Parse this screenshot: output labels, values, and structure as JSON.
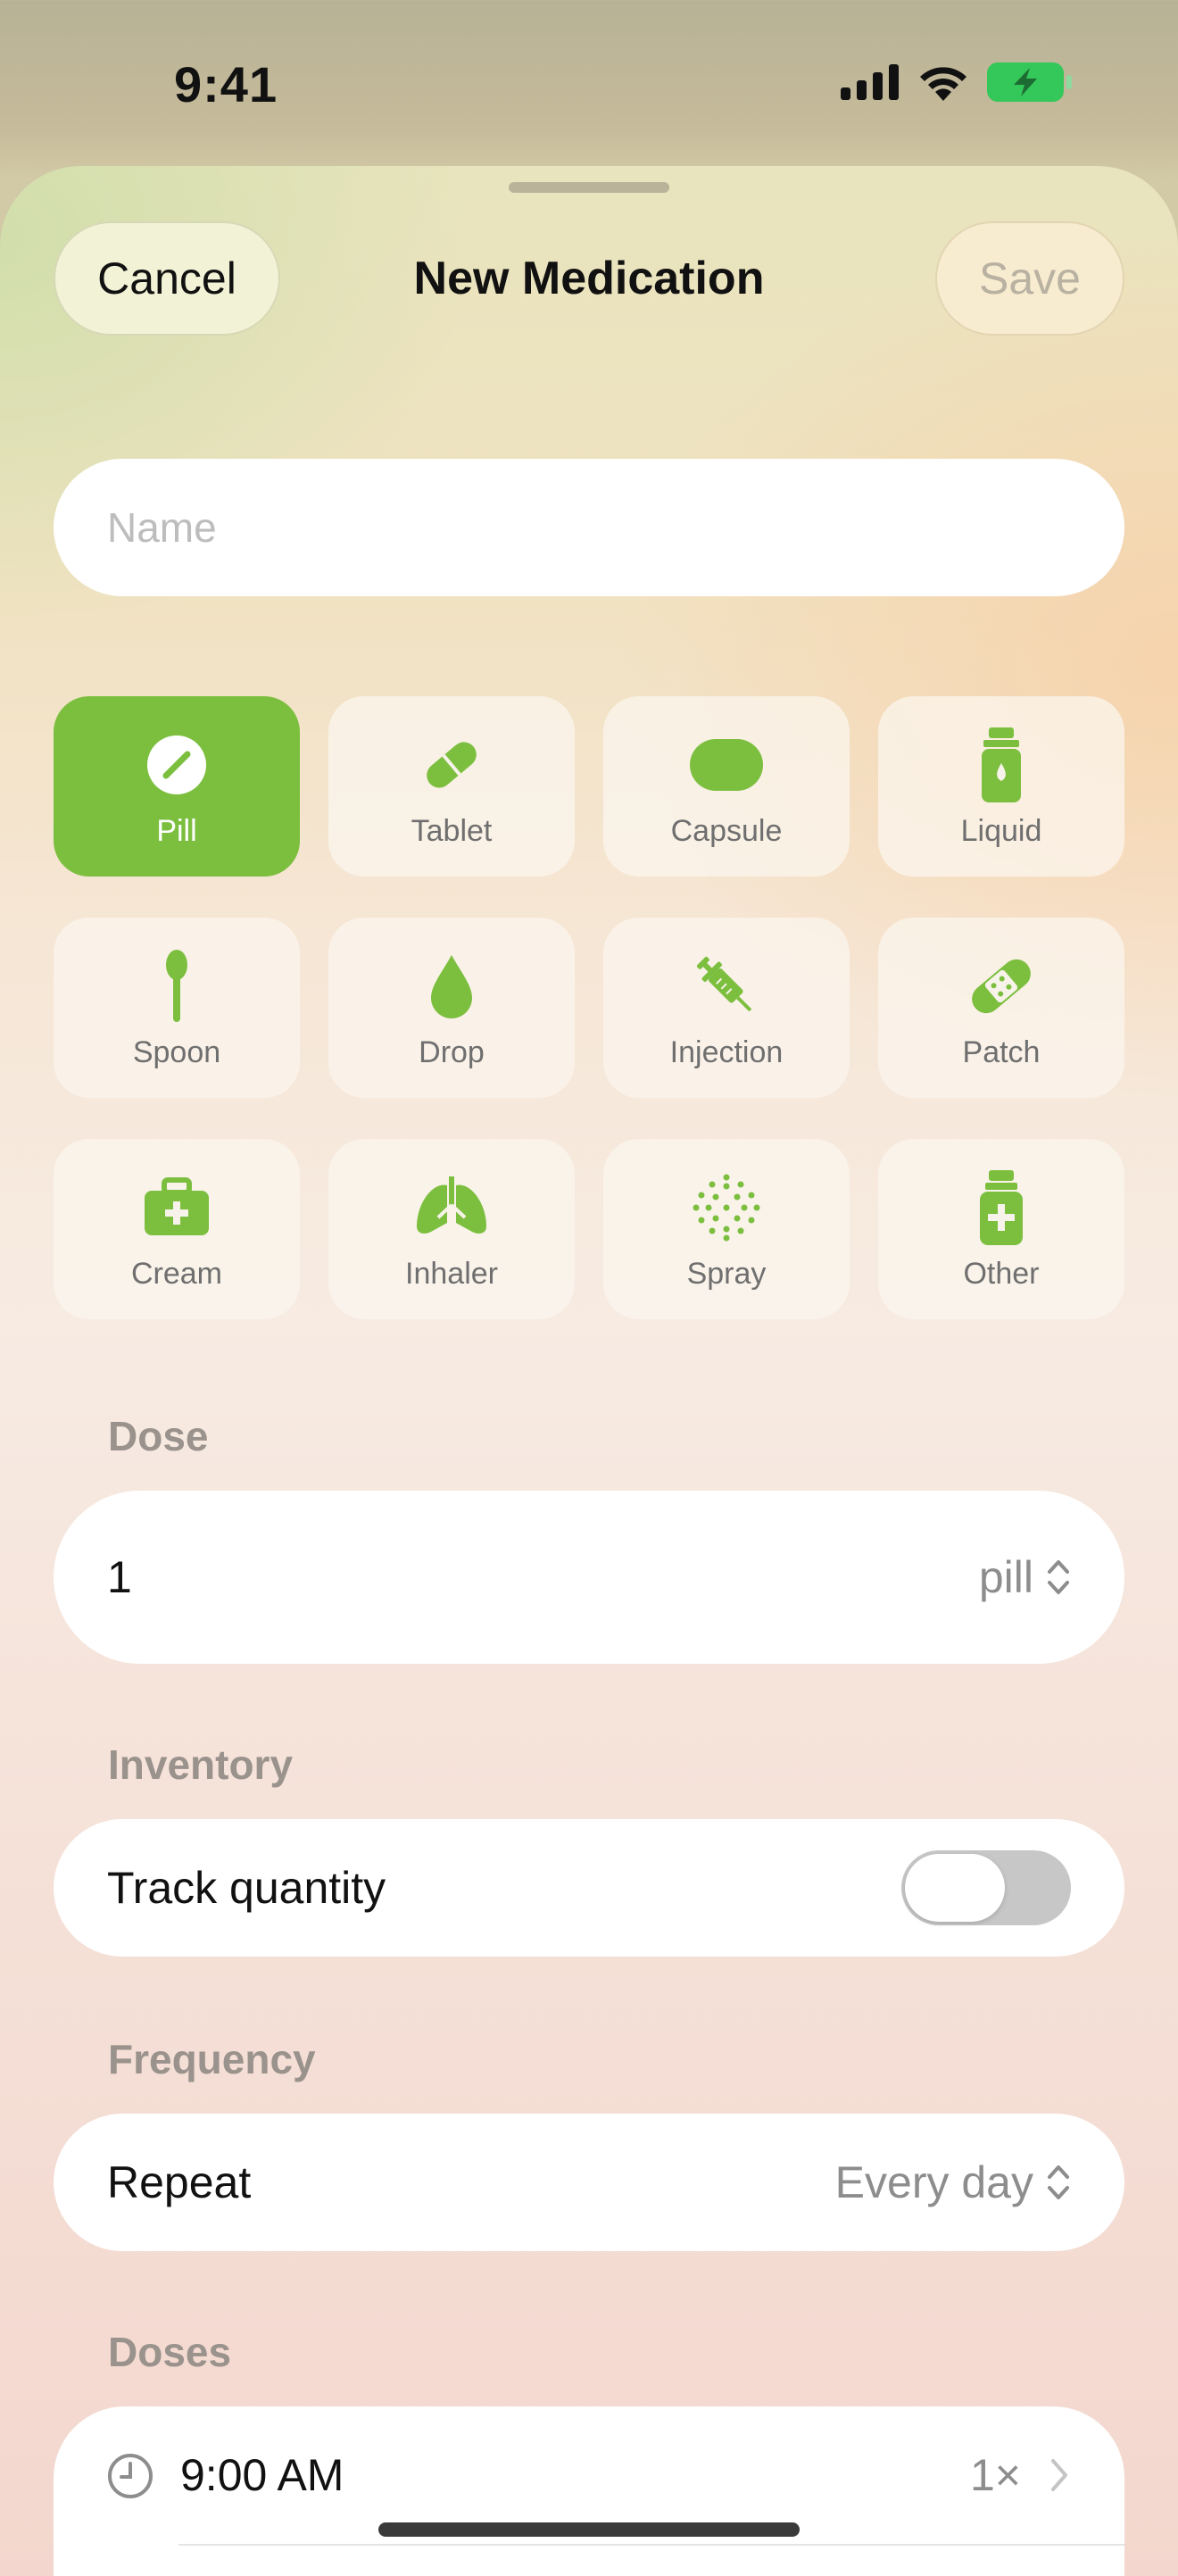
{
  "status": {
    "time": "9:41"
  },
  "header": {
    "cancel": "Cancel",
    "title": "New Medication",
    "save": "Save"
  },
  "name_field": {
    "placeholder": "Name",
    "value": ""
  },
  "forms": [
    {
      "label": "Pill",
      "icon": "pill-icon",
      "selected": true
    },
    {
      "label": "Tablet",
      "icon": "tablet-icon"
    },
    {
      "label": "Capsule",
      "icon": "capsule-icon"
    },
    {
      "label": "Liquid",
      "icon": "liquid-bottle-icon"
    },
    {
      "label": "Spoon",
      "icon": "spoon-icon"
    },
    {
      "label": "Drop",
      "icon": "drop-icon"
    },
    {
      "label": "Injection",
      "icon": "syringe-icon"
    },
    {
      "label": "Patch",
      "icon": "bandage-icon"
    },
    {
      "label": "Cream",
      "icon": "first-aid-kit-icon"
    },
    {
      "label": "Inhaler",
      "icon": "lungs-icon"
    },
    {
      "label": "Spray",
      "icon": "spray-dots-icon"
    },
    {
      "label": "Other",
      "icon": "medicine-bottle-icon"
    }
  ],
  "dose": {
    "section": "Dose",
    "amount": "1",
    "unit": "pill"
  },
  "inventory": {
    "section": "Inventory",
    "label": "Track quantity",
    "enabled": false
  },
  "frequency": {
    "section": "Frequency",
    "label": "Repeat",
    "value": "Every day"
  },
  "doses": {
    "section": "Doses",
    "time": "9:00 AM",
    "count": "1×"
  },
  "colors": {
    "accent": "#7cbf3f",
    "battery": "#34c759"
  }
}
